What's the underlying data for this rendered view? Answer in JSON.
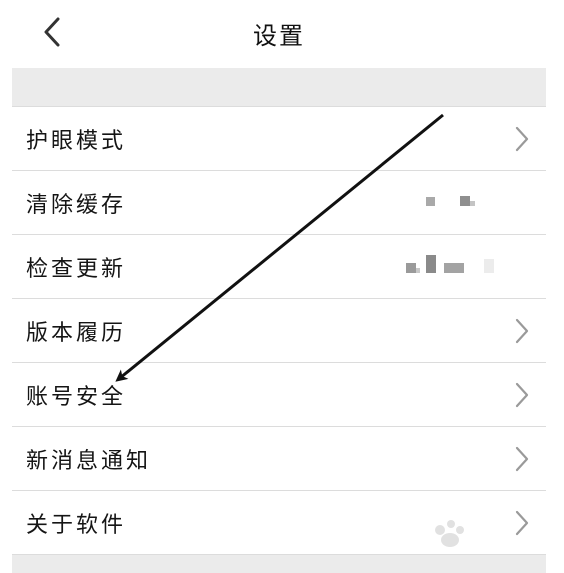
{
  "header": {
    "title": "设置"
  },
  "settings": {
    "items": [
      {
        "label": "护眼模式",
        "accessory": "chevron"
      },
      {
        "label": "清除缓存",
        "accessory": "obscured-value"
      },
      {
        "label": "检查更新",
        "accessory": "obscured-value"
      },
      {
        "label": "版本履历",
        "accessory": "chevron"
      },
      {
        "label": "账号安全",
        "accessory": "chevron"
      },
      {
        "label": "新消息通知",
        "accessory": "chevron"
      },
      {
        "label": "关于软件",
        "accessory": "chevron"
      }
    ]
  },
  "icons": {
    "back": "chevron-left-icon",
    "row_accessory": "chevron-right-icon"
  },
  "colors": {
    "background": "#ffffff",
    "band": "#ebebeb",
    "divider": "#dcdcdc",
    "text": "#151515",
    "chevron": "#9a9a9a",
    "annotation_arrow": "#111111"
  }
}
